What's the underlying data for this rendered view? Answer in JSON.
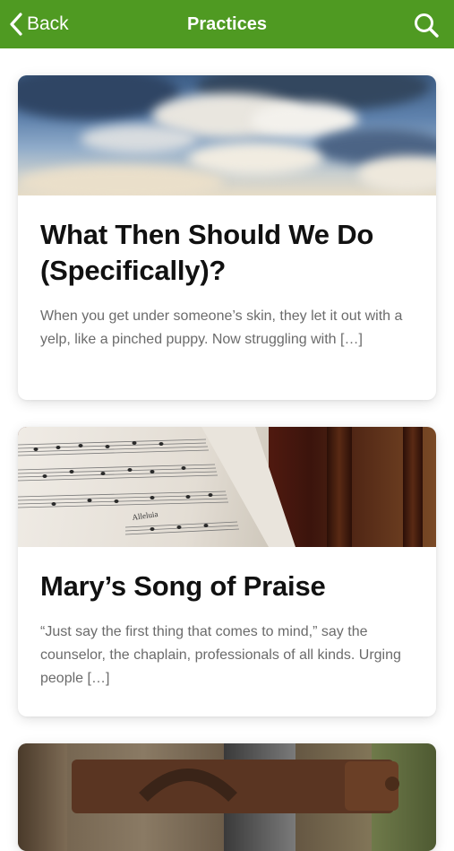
{
  "nav": {
    "back_label": "Back",
    "title": "Practices",
    "bar_color": "#4f9a22",
    "back_icon": "chevron-left-icon",
    "search_icon": "search-icon"
  },
  "posts": [
    {
      "title": "What Then Should We Do (Specifically)?",
      "excerpt": "When you get under someone’s skin, they let it out with a yelp, like a pinched puppy. Now struggling with […]",
      "image": "cloudy-sky-image"
    },
    {
      "title": "Mary’s Song of Praise",
      "excerpt": "“Just say the first thing that comes to mind,” say the counselor, the chaplain, professionals of all kinds. Urging people […]",
      "image": "hymnal-sheet-music-image",
      "image_text": "Alleluia"
    },
    {
      "image": "rusty-gate-latch-image"
    }
  ]
}
